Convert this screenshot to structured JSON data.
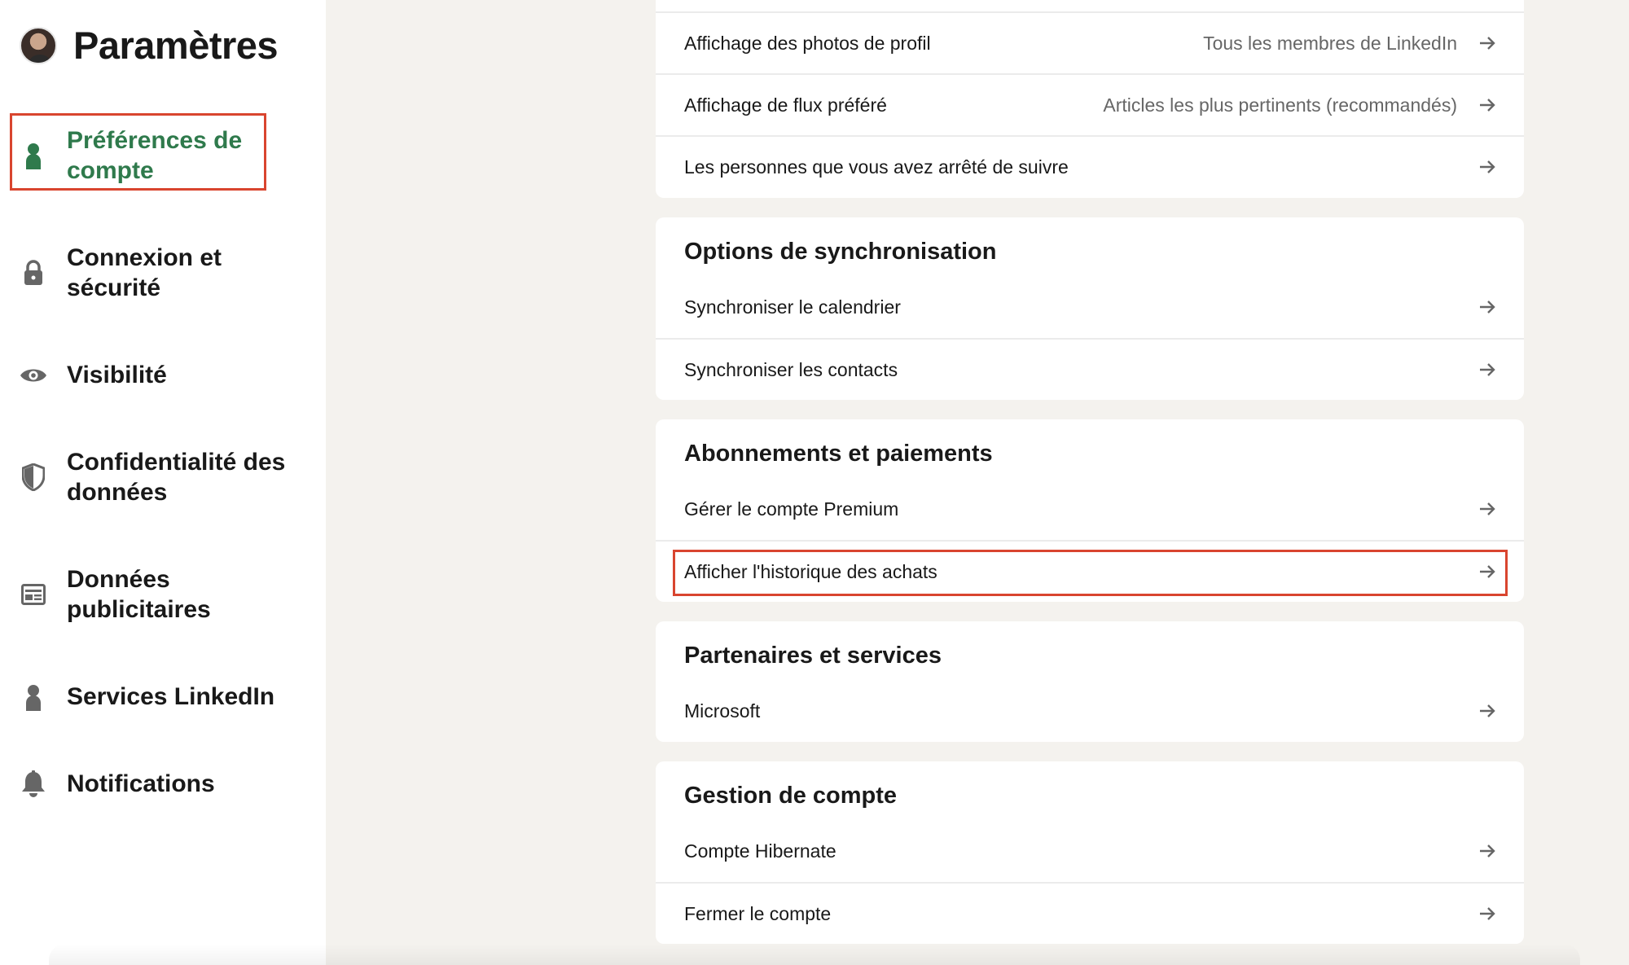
{
  "app": {
    "title": "Paramètres"
  },
  "sidebar": {
    "items": [
      {
        "label": "Préférences de compte",
        "icon": "person-icon",
        "active": true
      },
      {
        "label": "Connexion et sécurité",
        "icon": "lock-icon"
      },
      {
        "label": "Visibilité",
        "icon": "eye-icon"
      },
      {
        "label": "Confidentialité des données",
        "icon": "shield-icon"
      },
      {
        "label": "Données publicitaires",
        "icon": "ad-card-icon"
      },
      {
        "label": "Services LinkedIn",
        "icon": "person-icon"
      },
      {
        "label": "Notifications",
        "icon": "bell-icon"
      }
    ]
  },
  "main": {
    "top_card": {
      "rows": [
        {
          "label": "Affichage des photos de profil",
          "value": "Tous les membres de LinkedIn"
        },
        {
          "label": "Affichage de flux préféré",
          "value": "Articles les plus pertinents (recommandés)"
        },
        {
          "label": "Les personnes que vous avez arrêté de suivre"
        }
      ]
    },
    "sync_card": {
      "title": "Options de synchronisation",
      "rows": [
        {
          "label": "Synchroniser le calendrier"
        },
        {
          "label": "Synchroniser les contacts"
        }
      ]
    },
    "subscriptions_card": {
      "title": "Abonnements et paiements",
      "rows": [
        {
          "label": "Gérer le compte Premium"
        },
        {
          "label": "Afficher l'historique des achats"
        }
      ]
    },
    "partners_card": {
      "title": "Partenaires et services",
      "rows": [
        {
          "label": "Microsoft"
        }
      ]
    },
    "account_card": {
      "title": "Gestion de compte",
      "rows": [
        {
          "label": "Compte Hibernate"
        },
        {
          "label": "Fermer le compte"
        }
      ]
    }
  },
  "colors": {
    "accent_green": "#2f7a4c",
    "highlight_red": "#d9452f",
    "background": "#f4f2ee",
    "icon_gray": "#666666"
  }
}
